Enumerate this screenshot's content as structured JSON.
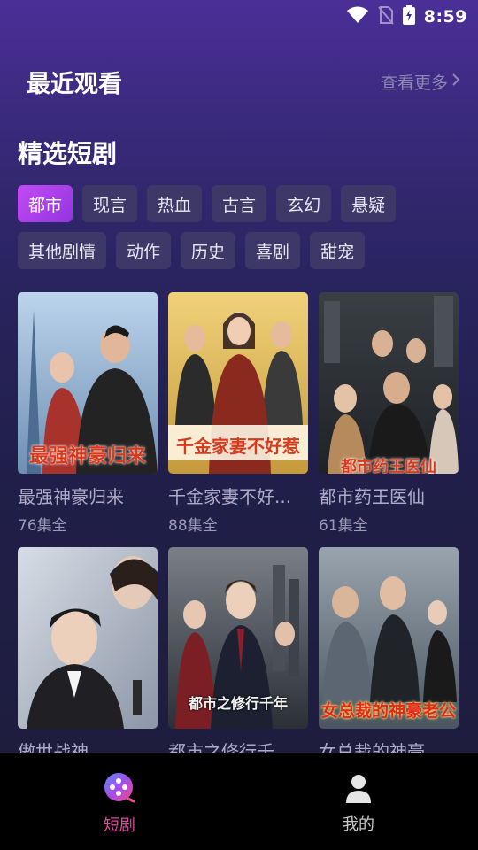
{
  "status_bar": {
    "time": "8:59"
  },
  "recent": {
    "title": "最近观看",
    "see_more": "查看更多"
  },
  "featured": {
    "title": "精选短剧"
  },
  "categories": {
    "row1": [
      "都市",
      "现言",
      "热血",
      "古言",
      "玄幻",
      "悬疑"
    ],
    "row2": [
      "其他剧情",
      "动作",
      "历史",
      "喜剧",
      "甜宠"
    ],
    "selected": "都市"
  },
  "dramas": [
    {
      "title": "最强神豪归来",
      "episodes": "76集全",
      "poster_text": "最强神豪归来"
    },
    {
      "title": "千金家妻不好...",
      "episodes": "88集全",
      "poster_text": "千金家妻不好惹"
    },
    {
      "title": "都市药王医仙",
      "episodes": "61集全",
      "poster_text": "都市药王医仙"
    },
    {
      "title": "傲世战神",
      "episodes": "",
      "poster_text": ""
    },
    {
      "title": "都市之修行千...",
      "episodes": "",
      "poster_text": "都市之修行千年"
    },
    {
      "title": "女总裁的神豪...",
      "episodes": "",
      "poster_text": "女总裁的神豪老公"
    }
  ],
  "bottom_nav": [
    {
      "label": "短剧",
      "icon": "play-circle-icon",
      "active": true
    },
    {
      "label": "我的",
      "icon": "person-icon",
      "active": false
    }
  ],
  "colors": {
    "accent": "#a63fe8",
    "nav_active": "#e2489e"
  }
}
